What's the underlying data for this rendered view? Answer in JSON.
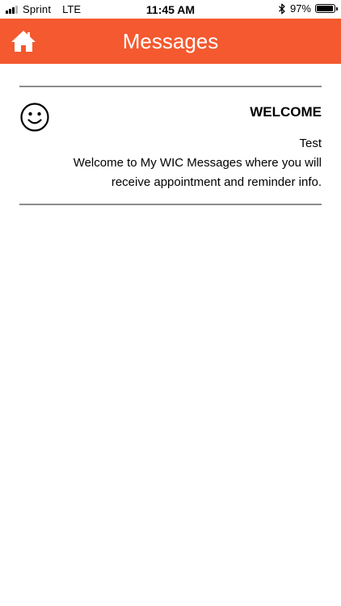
{
  "status_bar": {
    "carrier": "Sprint",
    "network": "LTE",
    "time": "11:45 AM",
    "battery_percent": "97%",
    "battery_level": 0.97,
    "signal_bars_filled": 3,
    "signal_bars_total": 4,
    "icons": [
      "signal-icon",
      "bluetooth-icon",
      "battery-icon"
    ]
  },
  "header": {
    "title": "Messages",
    "home_icon": "home-icon",
    "background_color": "#f4592f",
    "text_color": "#ffffff"
  },
  "messages": [
    {
      "icon": "smiley-face-icon",
      "title": "WELCOME",
      "sender": "Test",
      "body": "Welcome to My WIC Messages where you will receive appointment and reminder info."
    }
  ]
}
